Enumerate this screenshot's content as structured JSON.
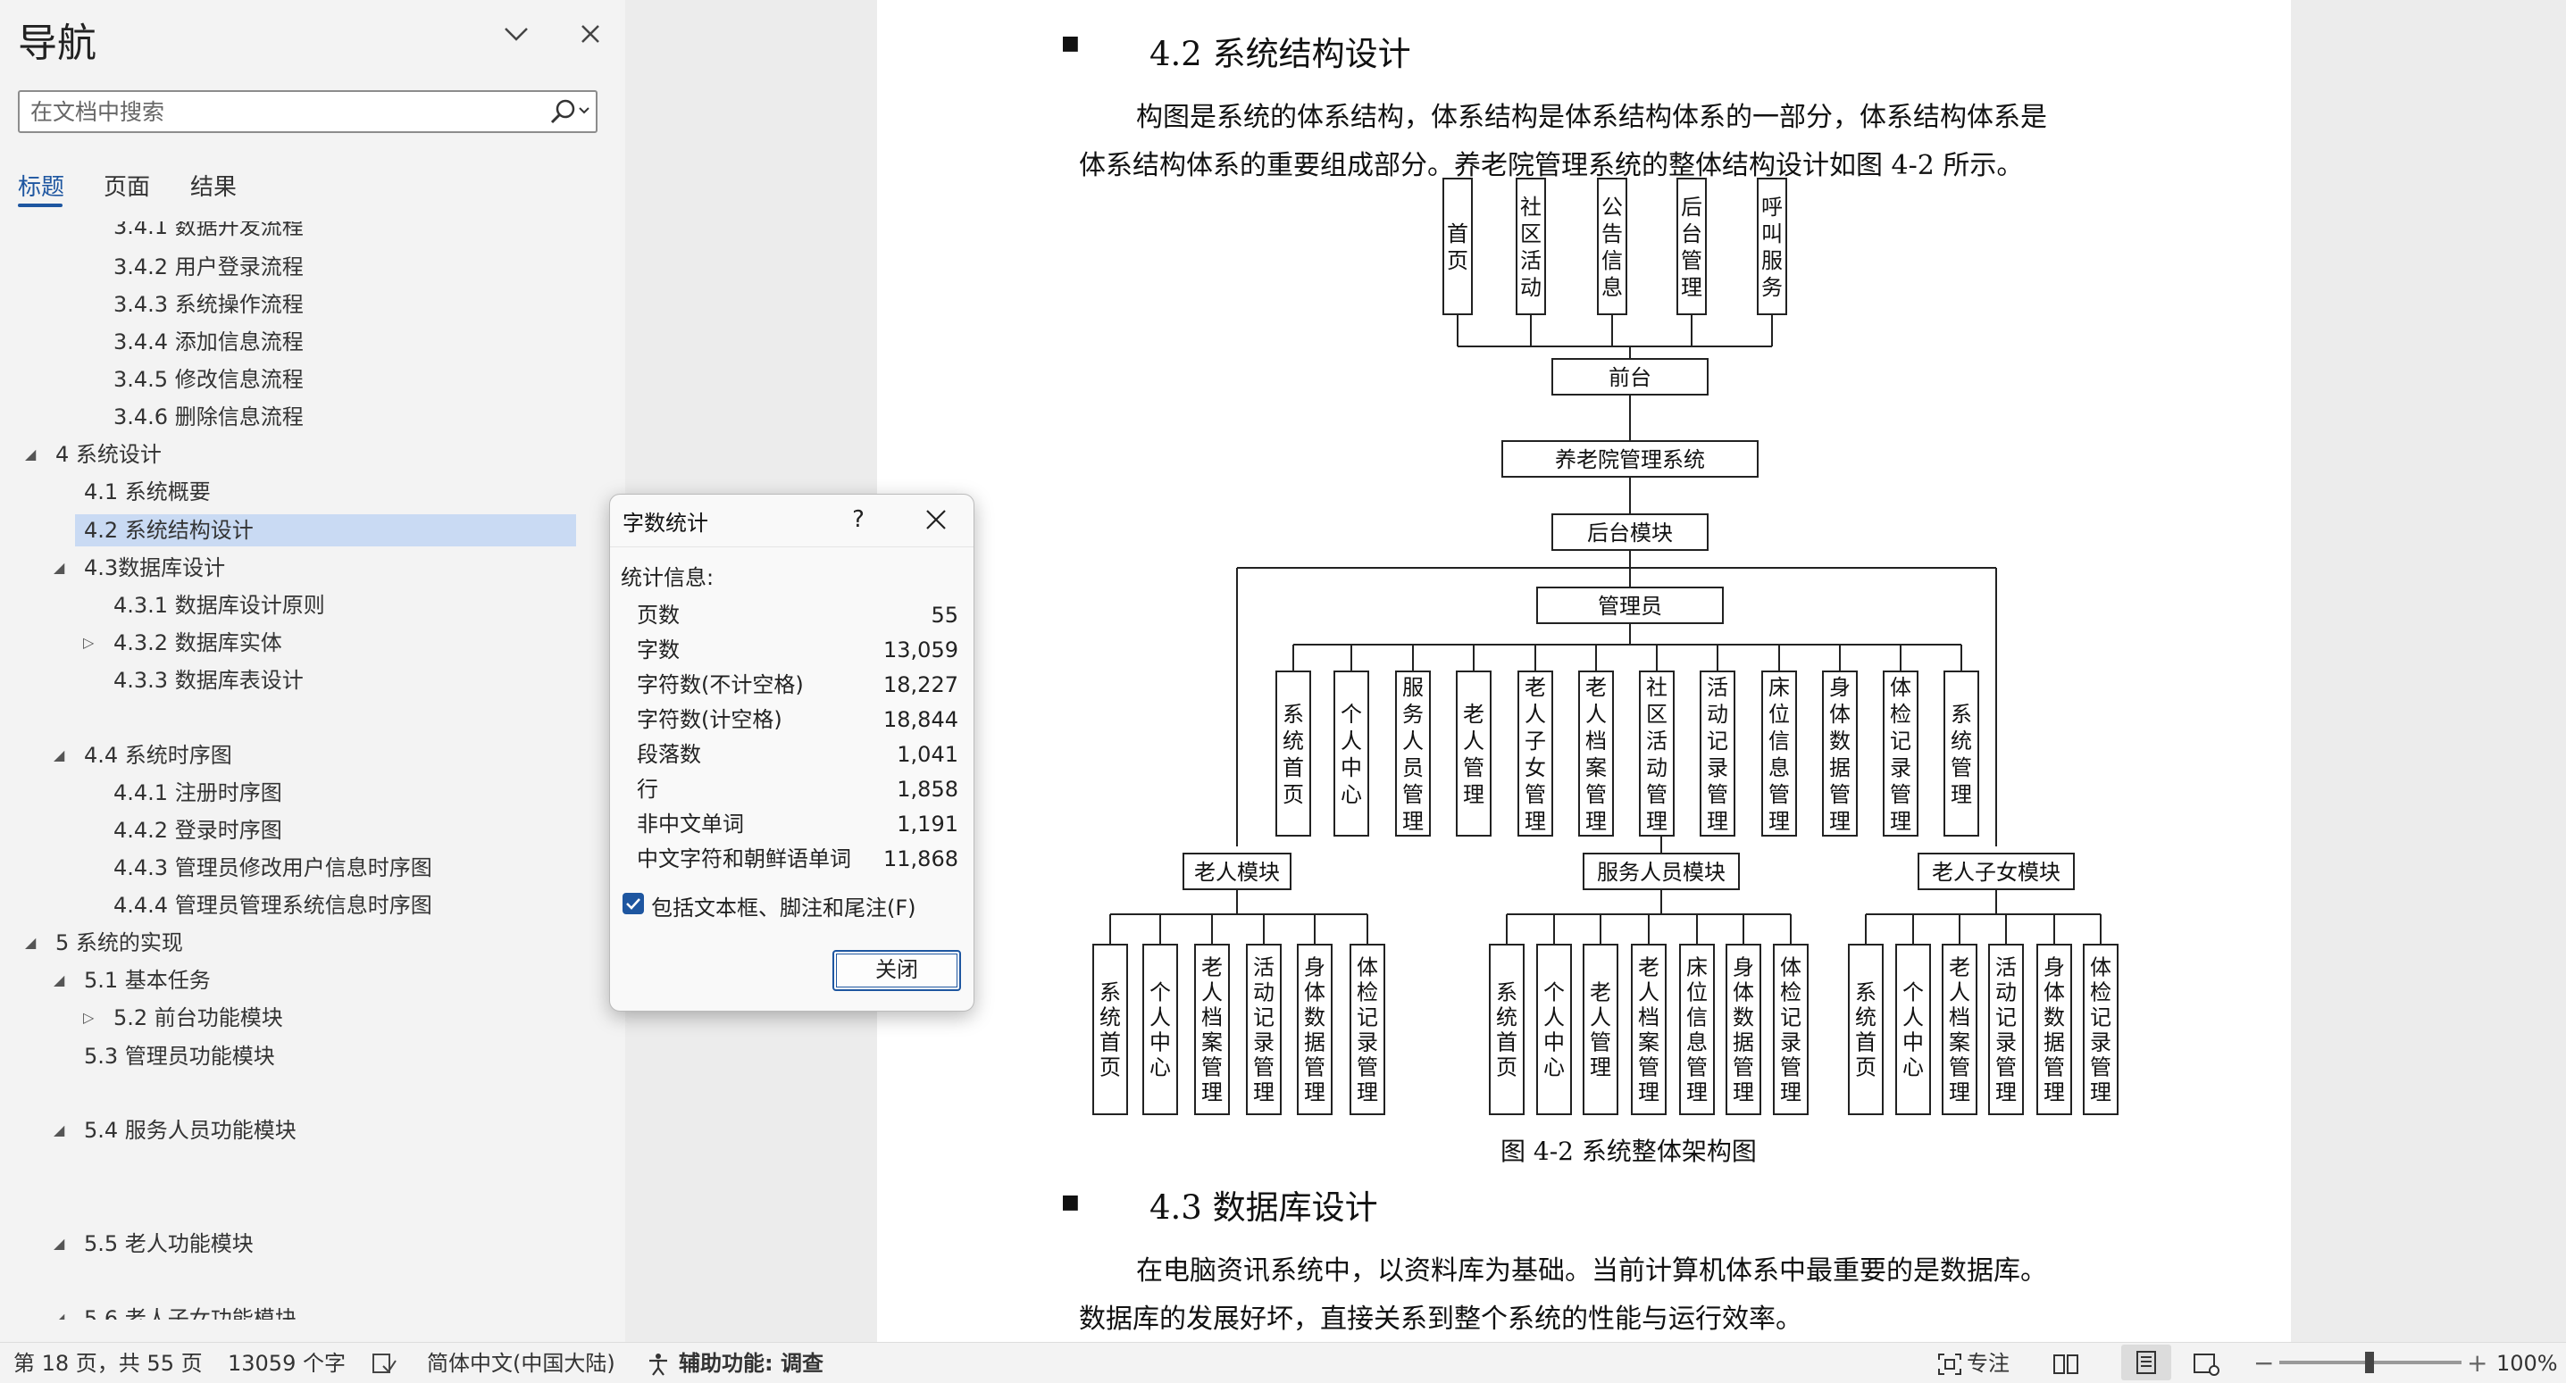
{
  "nav": {
    "title": "导航",
    "search_placeholder": "在文档中搜索",
    "tabs": [
      "标题",
      "页面",
      "结果"
    ],
    "headings": [
      {
        "label": "3.4.1 数据开发流程",
        "level": 3
      },
      {
        "label": "3.4.2 用户登录流程",
        "level": 3
      },
      {
        "label": "3.4.3 系统操作流程",
        "level": 3
      },
      {
        "label": "3.4.4 添加信息流程",
        "level": 3
      },
      {
        "label": "3.4.5 修改信息流程",
        "level": 3
      },
      {
        "label": "3.4.6 删除信息流程",
        "level": 3
      },
      {
        "label": "4 系统设计",
        "level": 1,
        "expander": "expanded"
      },
      {
        "label": "4.1 系统概要",
        "level": 2
      },
      {
        "label": "4.2 系统结构设计",
        "level": 2,
        "selected": true
      },
      {
        "label": "4.3数据库设计",
        "level": 2,
        "expander": "expanded"
      },
      {
        "label": "4.3.1 数据库设计原则",
        "level": 3
      },
      {
        "label": "4.3.2 数据库实体",
        "level": 3,
        "expander": "collapsed"
      },
      {
        "label": "4.3.3 数据库表设计",
        "level": 3
      },
      {
        "label": "4.4 系统时序图",
        "level": 2,
        "expander": "expanded"
      },
      {
        "label": "4.4.1 注册时序图",
        "level": 3
      },
      {
        "label": "4.4.2 登录时序图",
        "level": 3
      },
      {
        "label": "4.4.3 管理员修改用户信息时序图",
        "level": 3
      },
      {
        "label": "4.4.4 管理员管理系统信息时序图",
        "level": 3
      },
      {
        "label": "5 系统的实现",
        "level": 1,
        "expander": "expanded"
      },
      {
        "label": "5.1 基本任务",
        "level": 2,
        "expander": "expanded"
      },
      {
        "label": "5.2 前台功能模块",
        "level": 3,
        "expander": "collapsed"
      },
      {
        "label": "5.3 管理员功能模块",
        "level": 2
      },
      {
        "label": "5.4 服务人员功能模块",
        "level": 2,
        "expander": "expanded"
      },
      {
        "label": "5.5 老人功能模块",
        "level": 2,
        "expander": "expanded"
      },
      {
        "label": "5.6 老人子女功能模块",
        "level": 2,
        "expander": "expanded"
      }
    ]
  },
  "document": {
    "heading_42": "4.2  系统结构设计",
    "para1_line1": "构图是系统的体系结构，体系结构是体系结构体系的一部分，体系结构体系是",
    "para1_line2": "体系结构体系的重要组成部分。养老院管理系统的整体结构设计如图 4-2 所示。",
    "figure_caption": "图 4-2  系统整体架构图",
    "heading_43": "4.3 数据库设计",
    "para2_line1": "在电脑资讯系统中，以资料库为基础。当前计算机体系中最重要的是数据库。",
    "para2_line2": "数据库的发展好坏，直接关系到整个系统的性能与运行效率。",
    "diagram": {
      "top_items": [
        "首页",
        "社区活动",
        "公告信息",
        "后台管理",
        "呼叫服务"
      ],
      "frontend": "前台",
      "root": "养老院管理系统",
      "backend": "后台模块",
      "admin": "管理员",
      "admin_items": [
        "系统首页",
        "个人中心",
        "服务人员管理",
        "老人管理",
        "老人子女管理",
        "老人档案管理",
        "社区活动管理",
        "活动记录管理",
        "床位信息管理",
        "身体数据管理",
        "体检记录管理",
        "系统管理"
      ],
      "modules": [
        {
          "name": "老人模块",
          "items": [
            "系统首页",
            "个人中心",
            "老人档案管理",
            "活动记录管理",
            "身体数据管理",
            "体检记录管理"
          ]
        },
        {
          "name": "服务人员模块",
          "items": [
            "系统首页",
            "个人中心",
            "老人管理",
            "老人档案管理",
            "床位信息管理",
            "身体数据管理",
            "体检记录管理"
          ]
        },
        {
          "name": "老人子女模块",
          "items": [
            "系统首页",
            "个人中心",
            "老人档案管理",
            "活动记录管理",
            "身体数据管理",
            "体检记录管理"
          ]
        }
      ]
    }
  },
  "dialog": {
    "title": "字数统计",
    "help": "?",
    "stats_label": "统计信息:",
    "stats": [
      {
        "k": "页数",
        "v": "55"
      },
      {
        "k": "字数",
        "v": "13,059"
      },
      {
        "k": "字符数(不计空格)",
        "v": "18,227"
      },
      {
        "k": "字符数(计空格)",
        "v": "18,844"
      },
      {
        "k": "段落数",
        "v": "1,041"
      },
      {
        "k": "行",
        "v": "1,858"
      },
      {
        "k": "非中文单词",
        "v": "1,191"
      },
      {
        "k": "中文字符和朝鲜语单词",
        "v": "11,868"
      }
    ],
    "checkbox_label": "包括文本框、脚注和尾注(F)",
    "checkbox_checked": true,
    "close_button": "关闭"
  },
  "status": {
    "page": "第 18 页，共 55 页",
    "words": "13059 个字",
    "language": "简体中文(中国大陆)",
    "accessibility": "辅助功能: 调查",
    "focus": "专注",
    "zoom": "100%"
  },
  "colors": {
    "accent": "#1e56a0",
    "selection": "#c9daf3"
  }
}
